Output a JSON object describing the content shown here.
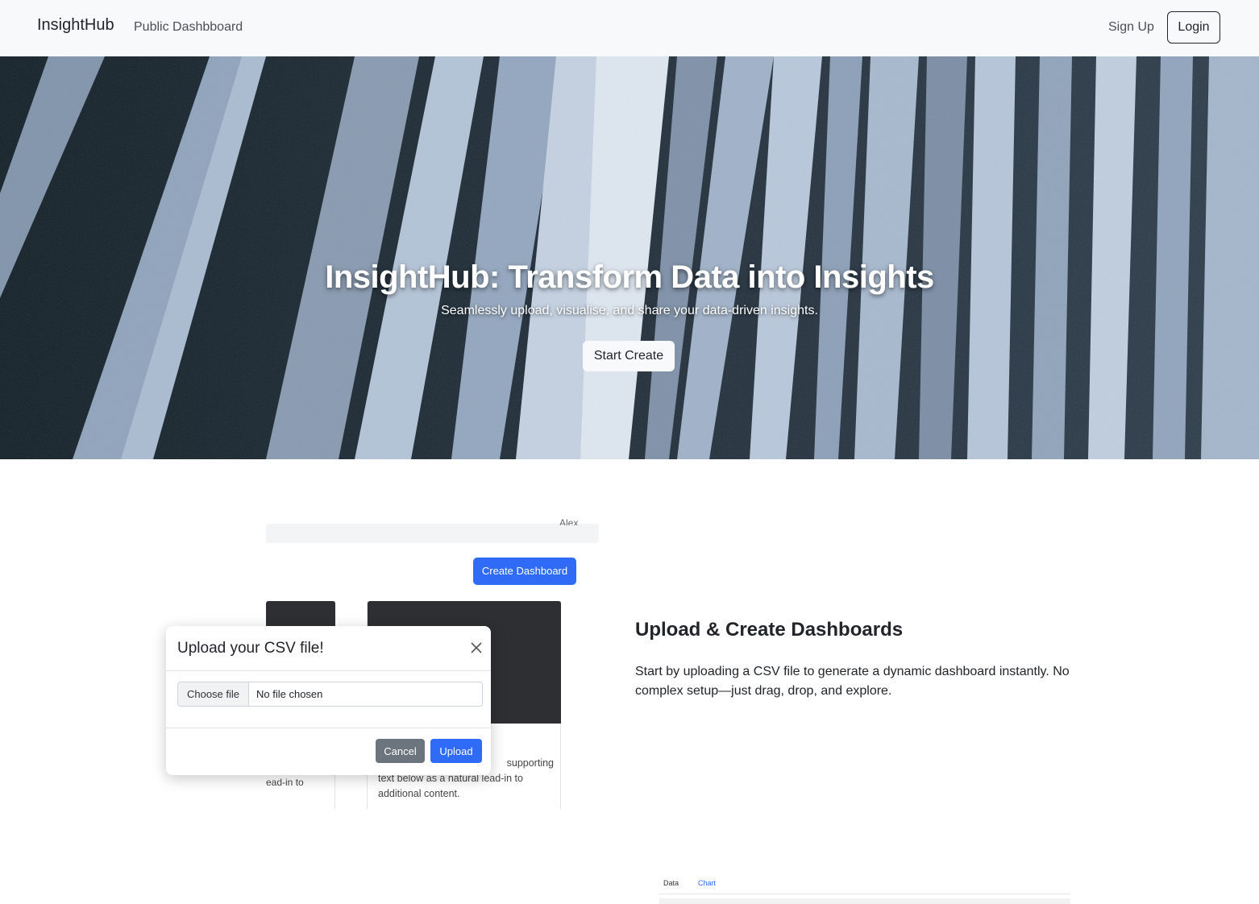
{
  "navbar": {
    "brand": "InsightHub",
    "public_dashboard": "Public Dashbboard",
    "sign_up": "Sign Up",
    "login": "Login"
  },
  "hero": {
    "title": "InsightHub: Transform Data into Insights",
    "subtitle": "Seamlessly upload, visualise, and share your data-driven insights.",
    "cta": "Start Create"
  },
  "feature_upload": {
    "heading": "Upload & Create Dashboards",
    "text": "Start by uploading a CSV file to generate a dynamic dashboard instantly. No complex setup—just drag, drop, and explore.",
    "mock": {
      "user_name": "Alex",
      "create_dashboard": "Create Dashboard",
      "card_left_text": "ead-in to",
      "card_right_text_1": "supporting",
      "card_right_text_2": "text below as a natural lead-in to",
      "card_right_text_3": "additional content.",
      "modal": {
        "title": "Upload your CSV file!",
        "choose_file": "Choose file",
        "no_file": "No file chosen",
        "cancel": "Cancel",
        "upload": "Upload"
      }
    }
  },
  "feature_next": {
    "mock": {
      "tab_data": "Data",
      "tab_chart": "Chart"
    }
  },
  "colors": {
    "navbar_bg": "#f8f9fa",
    "primary": "#2f6bf6",
    "secondary": "#6c757d",
    "text": "#212529"
  }
}
